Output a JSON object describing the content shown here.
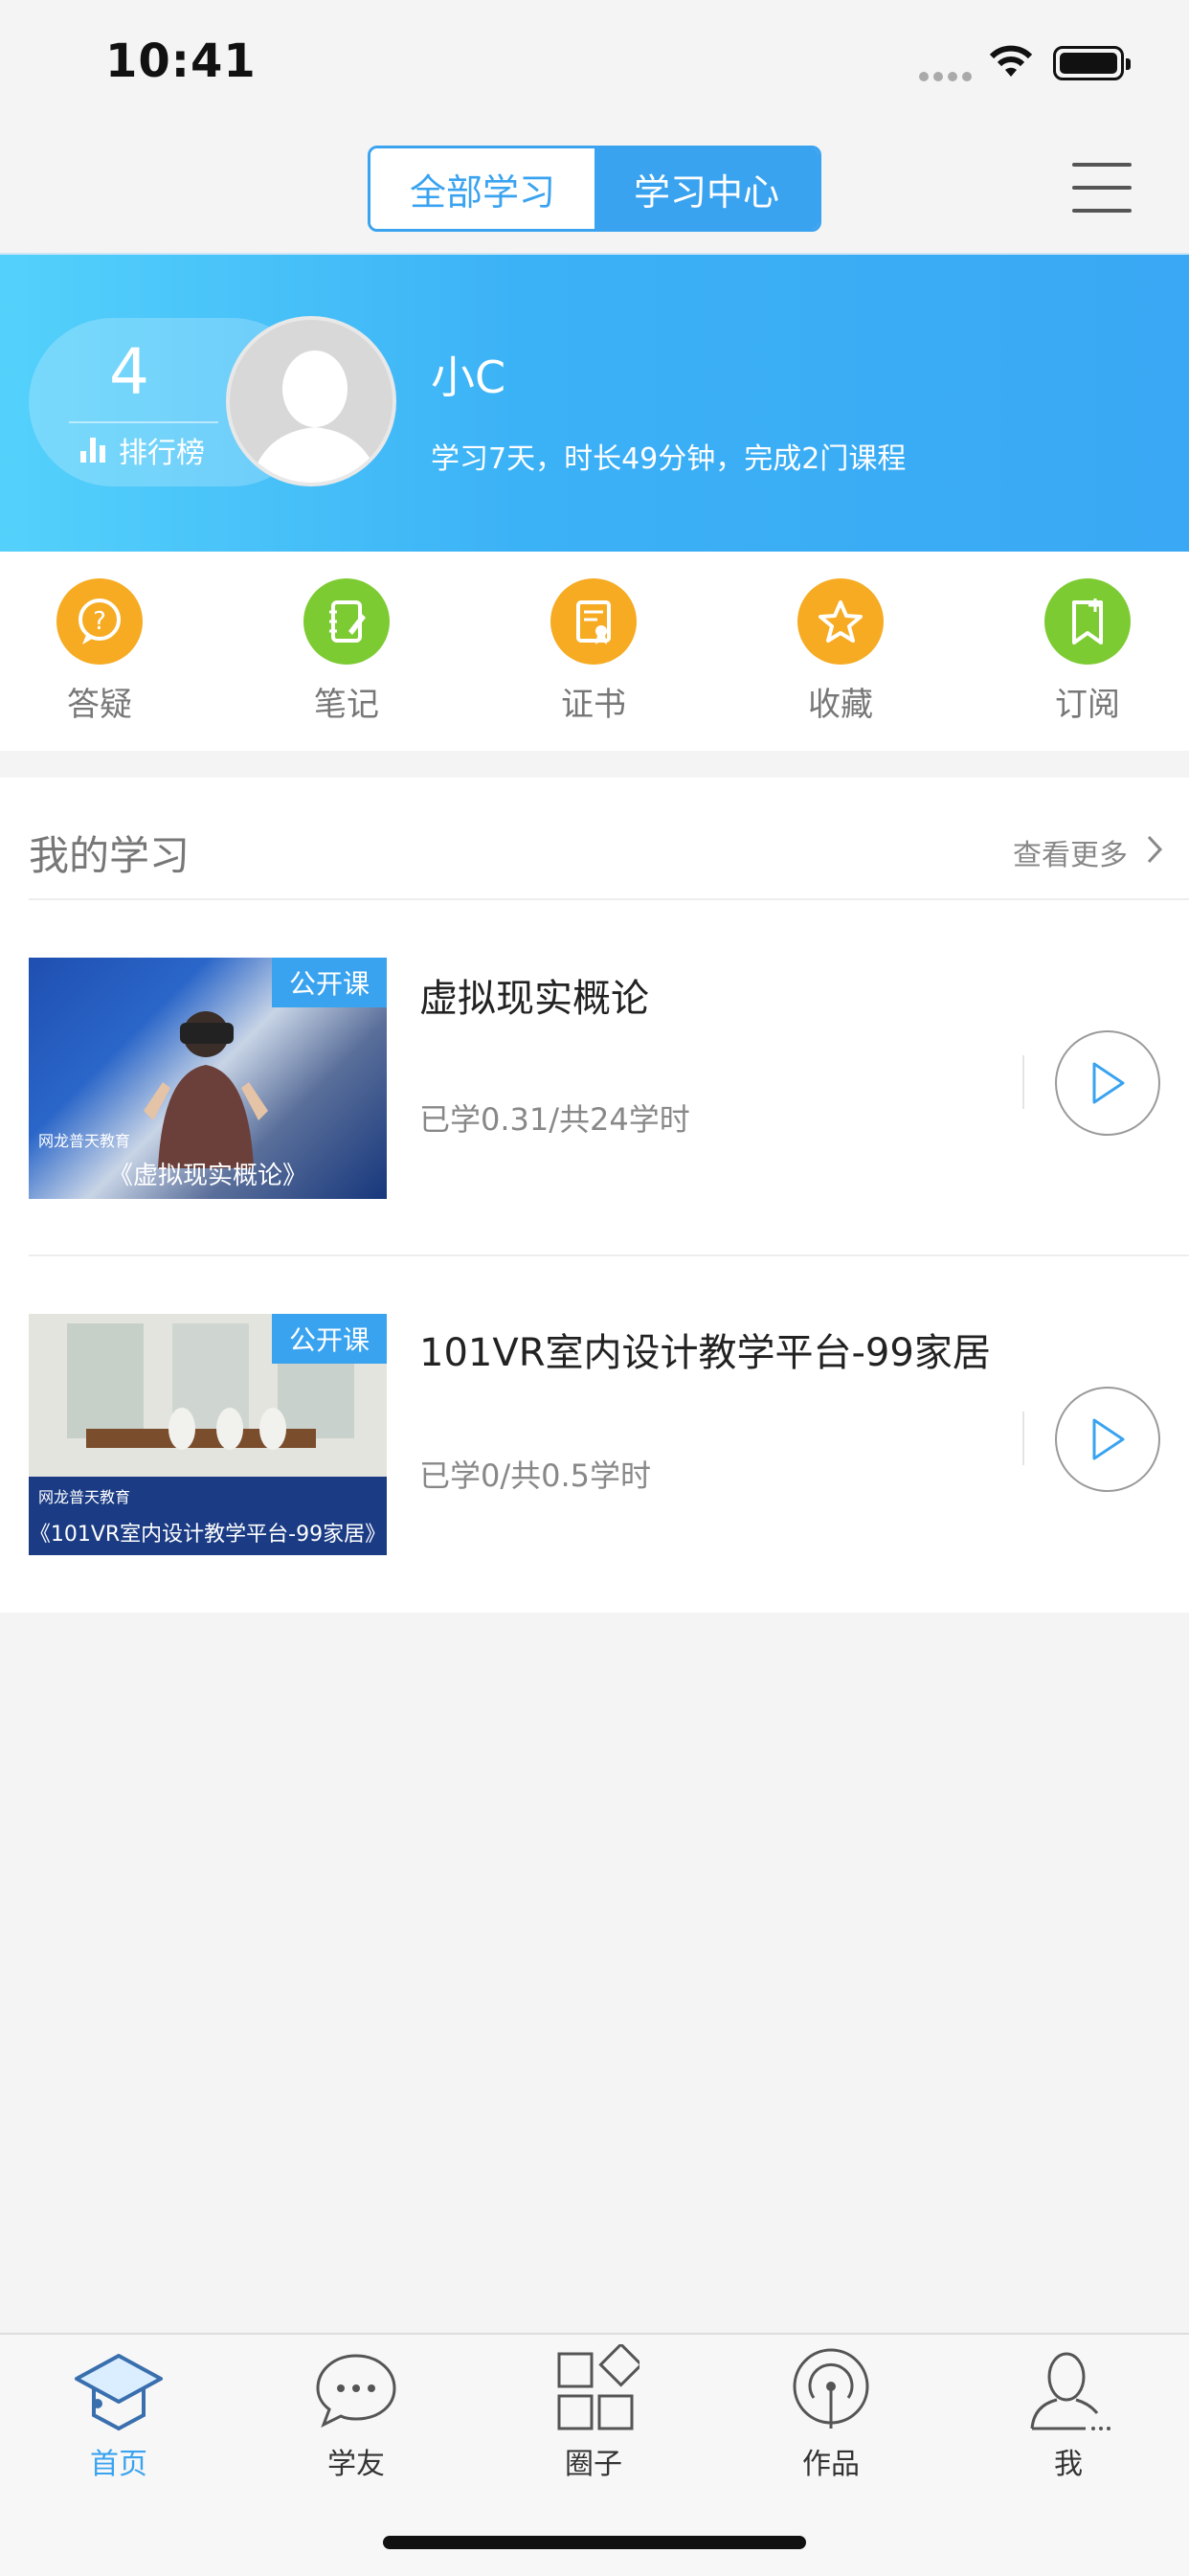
{
  "status_bar": {
    "time": "10:41"
  },
  "header": {
    "segments": [
      "全部学习",
      "学习中心"
    ],
    "active_segment": 1,
    "menu_icon": "hamburger-icon",
    "accent_color": "#3aa3f0"
  },
  "profile": {
    "rank": "4",
    "rank_label": "排行榜",
    "name": "小C",
    "stats": "学习7天，时长49分钟，完成2门课程"
  },
  "actions": [
    {
      "label": "答疑",
      "icon": "question-bubble-icon",
      "color": "#f6ab22"
    },
    {
      "label": "笔记",
      "icon": "notebook-icon",
      "color": "#7dcb32"
    },
    {
      "label": "证书",
      "icon": "certificate-icon",
      "color": "#f6ab22"
    },
    {
      "label": "收藏",
      "icon": "star-icon",
      "color": "#f6ab22"
    },
    {
      "label": "订阅",
      "icon": "bookmark-plus-icon",
      "color": "#7dcb32"
    }
  ],
  "my_learning": {
    "title": "我的学习",
    "more": "查看更多",
    "courses": [
      {
        "badge": "公开课",
        "brand": "网龙普天教育",
        "thumb_caption": "《虚拟现实概论》",
        "title": "虚拟现实概论",
        "progress": "已学0.31/共24学时"
      },
      {
        "badge": "公开课",
        "brand": "网龙普天教育",
        "thumb_caption": "《101VR室内设计教学平台-99家居》",
        "title": "101VR室内设计教学平台-99家居",
        "progress": "已学0/共0.5学时"
      }
    ]
  },
  "tabbar": {
    "tabs": [
      {
        "label": "首页",
        "icon": "graduation-cap-icon",
        "active": true
      },
      {
        "label": "学友",
        "icon": "chat-bubble-icon",
        "active": false
      },
      {
        "label": "圈子",
        "icon": "grid-apps-icon",
        "active": false
      },
      {
        "label": "作品",
        "icon": "broadcast-icon",
        "active": false
      },
      {
        "label": "我",
        "icon": "user-icon",
        "active": false
      }
    ]
  }
}
